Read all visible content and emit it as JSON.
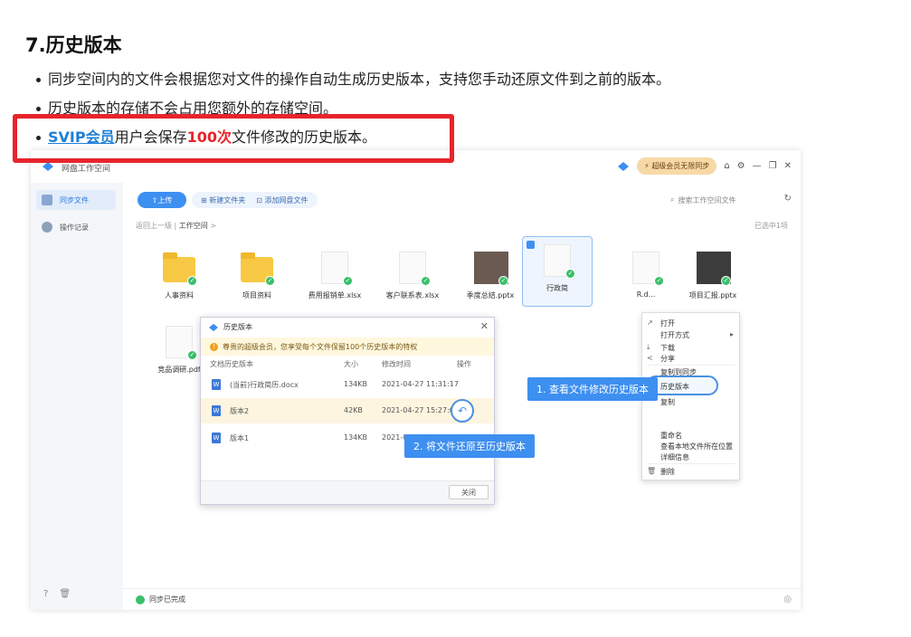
{
  "doc": {
    "heading": "7.历史版本",
    "bullet1": "同步空间内的文件会根据您对文件的操作自动生成历史版本，支持您手动还原文件到之前的版本。",
    "bullet2": "历史版本的存储不会占用您额外的存储空间。",
    "bullet3": {
      "svip": "SVIP会员",
      "mid": "用户会保存",
      "count": "100次",
      "tail": "文件修改的历史版本。"
    }
  },
  "app": {
    "title": "网盘工作空间",
    "vip_button": "超级会员无限同步",
    "sidebar": [
      "同步文件",
      "操作记录"
    ],
    "toolbar": {
      "upload": "上传",
      "new_folder": "新建文件夹",
      "add_files": "添加网盘文件"
    },
    "search_placeholder": "搜索工作空间文件",
    "breadcrumb": {
      "back": "返回上一级",
      "current": "工作空间",
      "arrow": ">"
    },
    "selected_count": "已选中1项",
    "files": [
      {
        "name": "人事资料"
      },
      {
        "name": "项目资料"
      },
      {
        "name": "费用报销单.xlsx"
      },
      {
        "name": "客户联系表.xlsx"
      },
      {
        "name": "季度总结.pptx"
      },
      {
        "name": "行政简"
      },
      {
        "name": "R.d..."
      },
      {
        "name": "项目汇报.pptx"
      },
      {
        "name": "竞品调研.pdf"
      }
    ],
    "context_menu": [
      "打开",
      "打开方式",
      "下载",
      "分享",
      "复制到同步",
      "历史版本",
      "复制",
      "重命名",
      "查看本地文件所在位置",
      "详细信息",
      "删除"
    ],
    "callout1": "1. 查看文件修改历史版本",
    "callout2": "2. 将文件还原至历史版本",
    "dialog": {
      "title": "历史版本",
      "banner": "尊贵的超级会员，您享受每个文件保留100个历史版本的特权",
      "columns": [
        "文档历史版本",
        "大小",
        "修改时间",
        "操作"
      ],
      "rows": [
        {
          "name": "(当前)行政简历.docx",
          "size": "134KB",
          "time": "2021-04-27 11:31:17"
        },
        {
          "name": "版本2",
          "size": "42KB",
          "time": "2021-04-27 15:27:06"
        },
        {
          "name": "版本1",
          "size": "134KB",
          "time": "2021-0"
        }
      ],
      "close": "关闭"
    },
    "status": "同步已完成"
  },
  "colors": {
    "accent": "#3d8ff0",
    "red": "#e8242b",
    "svip": "#1f7fd6",
    "ok": "#3bbf6b"
  }
}
